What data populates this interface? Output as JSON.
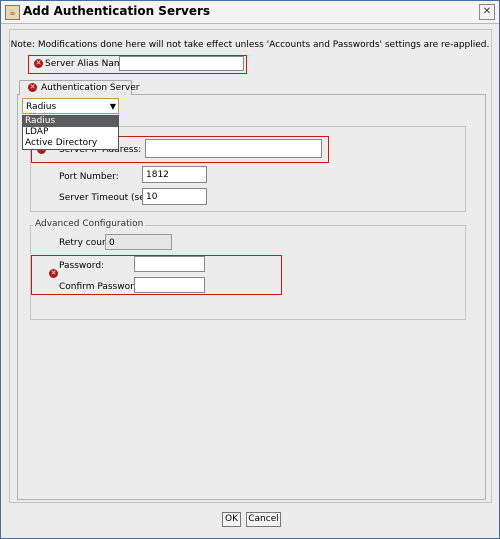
{
  "window": {
    "title": "Add Authentication Servers"
  },
  "note": "Note: Modifications done here will not take effect unless 'Accounts and Passwords' settings are re-applied.",
  "alias": {
    "label": "Server Alias Name:",
    "value": ""
  },
  "tab": {
    "label": "Authentication Server"
  },
  "server_type": {
    "selected": "Radius",
    "options": [
      "Radius",
      "LDAP",
      "Active Directory"
    ]
  },
  "server": {
    "address_label": "Server IP Address:",
    "address_value": "",
    "port_label": "Port Number:",
    "port_value": "1812",
    "timeout_label": "Server Timeout (sec):",
    "timeout_value": "10"
  },
  "advanced": {
    "title": "Advanced Configuration",
    "retry_label": "Retry count:",
    "retry_value": "0",
    "password_label": "Password:",
    "password_value": "",
    "confirm_label": "Confirm Password:",
    "confirm_value": ""
  },
  "buttons": {
    "ok": "OK",
    "cancel": "Cancel"
  },
  "colors": {
    "error": "#c41a1a",
    "focus": "#c49d2c"
  }
}
